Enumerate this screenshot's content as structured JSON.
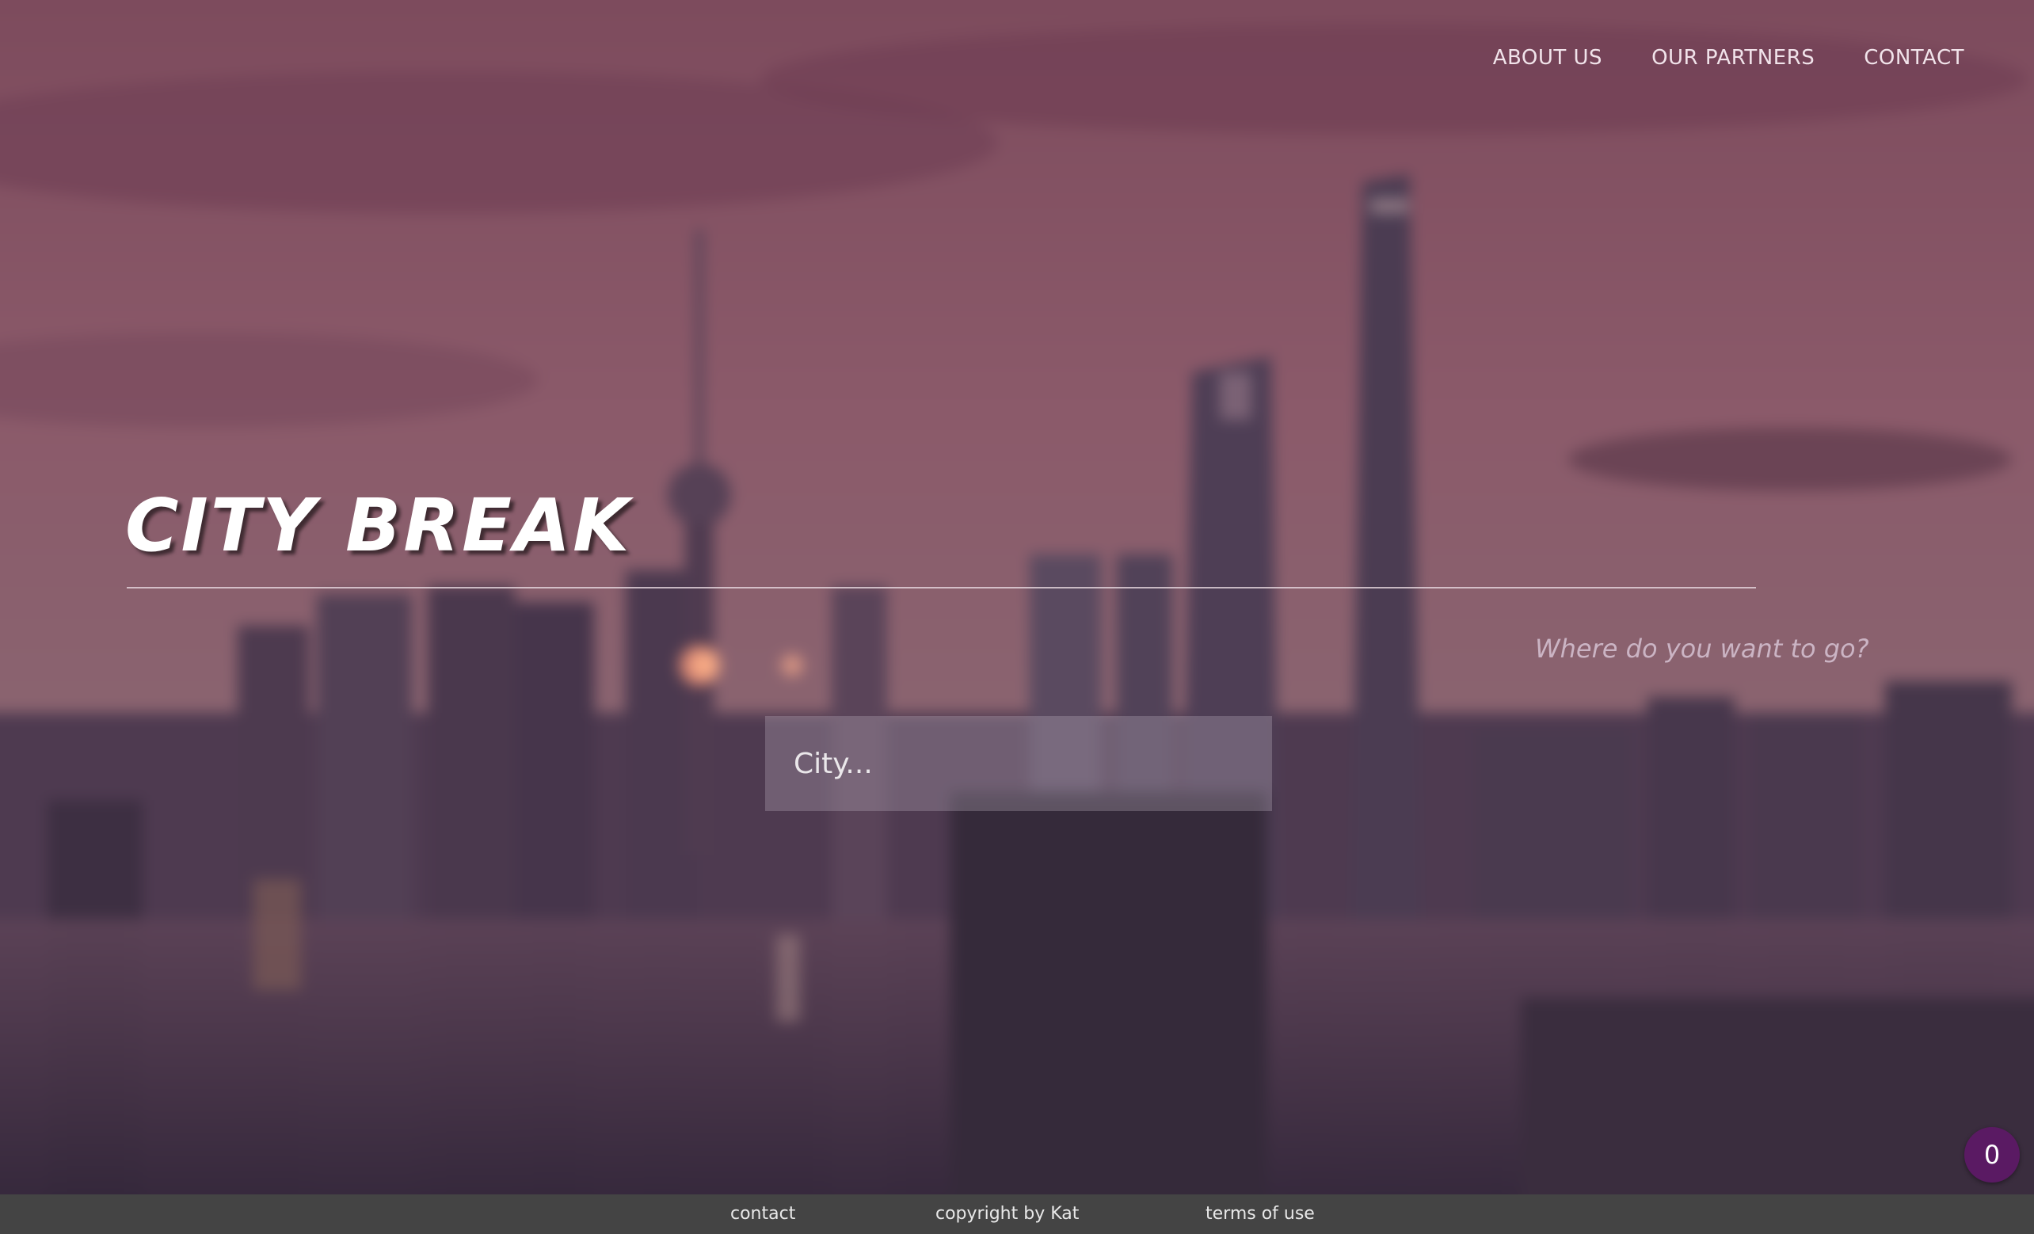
{
  "nav": {
    "items": [
      {
        "label": "ABOUT US"
      },
      {
        "label": "OUR PARTNERS"
      },
      {
        "label": "CONTACT"
      }
    ]
  },
  "hero": {
    "title": "CITY BREAK",
    "tagline": "Where do you want to go?"
  },
  "search": {
    "placeholder": "City...",
    "value": ""
  },
  "footer": {
    "contact": "contact",
    "copyright": "copyright by Kat",
    "terms": "terms of use"
  },
  "badge": {
    "count": "0"
  },
  "colors": {
    "background_tint": "#7a4f66",
    "footer": "#444444",
    "badge": "#5a1a63",
    "title": "#ffffff"
  }
}
